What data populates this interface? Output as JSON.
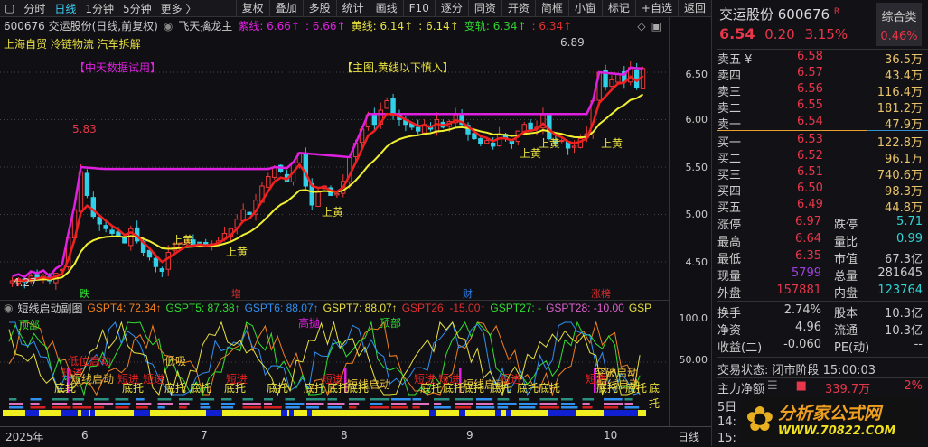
{
  "toolbar": {
    "items": [
      "分时",
      "日线",
      "1分钟",
      "5分钟",
      "更多 〉"
    ],
    "right": [
      "复权",
      "叠加",
      "多股",
      "统计",
      "画线",
      "F10",
      "逐分",
      "同资",
      "开资",
      "简框",
      "小窗",
      "标记",
      "+自选",
      "返回"
    ]
  },
  "info": {
    "title": "600676 交运股份(日线,前复权)",
    "indicator": "飞天擒龙主",
    "zx": "紫线: 6.66↑",
    "zx2": ": 6.66↑",
    "hx": "黄线: 6.14↑",
    "hx2": ": 6.14↑",
    "bg": "变轨: 6.34↑",
    "bg2": ": 6.34↑"
  },
  "main": {
    "concepts": "上海自贸 冷链物流 汽车拆解",
    "trial": "【中天数据试用】",
    "note": "【主图,黄线以下慎入】",
    "high_label": "5.83",
    "peak_label": "6.89",
    "low_label": "4.27",
    "shang_huang": "上黄",
    "events": [
      "跌",
      "增",
      "财",
      "涨榜"
    ],
    "yaxis": [
      "6.50",
      "6.00",
      "5.50",
      "5.00",
      "4.50"
    ]
  },
  "chart_data": {
    "type": "candlestick",
    "ylim": [
      4.2,
      6.95
    ],
    "closes": [
      4.3,
      4.32,
      4.29,
      4.35,
      4.33,
      4.36,
      4.3,
      4.38,
      4.42,
      4.75,
      5.05,
      5.45,
      5.2,
      4.98,
      4.9,
      4.85,
      4.8,
      4.78,
      4.7,
      4.85,
      4.72,
      4.6,
      4.55,
      4.45,
      4.4,
      4.6,
      4.65,
      4.7,
      4.72,
      4.68,
      4.7,
      4.66,
      4.69,
      4.72,
      4.8,
      4.85,
      4.95,
      5.05,
      5.0,
      5.15,
      5.3,
      5.4,
      5.5,
      5.45,
      5.35,
      5.55,
      5.65,
      5.3,
      5.1,
      5.25,
      5.3,
      5.2,
      5.22,
      5.35,
      5.6,
      5.75,
      5.9,
      6.05,
      5.95,
      6.1,
      6.2,
      6.05,
      6.0,
      5.95,
      5.92,
      5.88,
      5.95,
      5.9,
      6.0,
      5.92,
      5.98,
      6.05,
      5.95,
      5.85,
      5.8,
      5.75,
      5.78,
      5.72,
      5.85,
      5.8,
      5.75,
      5.88,
      5.95,
      5.9,
      5.92,
      6.05,
      5.8,
      5.75,
      5.78,
      5.7,
      5.72,
      5.8,
      5.85,
      6.2,
      6.5,
      6.35,
      6.42,
      6.48,
      6.4,
      6.55,
      6.34,
      6.54
    ]
  },
  "sub": {
    "title": "短线启动副图",
    "gspt4": "GSPT4: 72.34↑",
    "gspt5": "GSPT5: 87.38↑",
    "gspt6": "GSPT6: 88.07↑",
    "gspt7": "GSPT7: 88.07↑",
    "gspt26": "GSPT26: -15.00↑",
    "gspt27": "GSPT27: -",
    "gspt28": "GSPT28: -10.00",
    "gsp": "GSP",
    "yaxis": [
      "100.0",
      "50.00"
    ],
    "labels": [
      {
        "t": "顶部",
        "c": "#30e030",
        "x": 20,
        "y": 2
      },
      {
        "t": "高抛",
        "c": "#e020e0",
        "x": 330,
        "y": 0
      },
      {
        "t": "顶部",
        "c": "#30e030",
        "x": 420,
        "y": 0
      },
      {
        "t": "低位启动",
        "c": "#e82020",
        "x": 75,
        "y": 32
      },
      {
        "t": "短进",
        "c": "#e82020",
        "x": 68,
        "y": 45
      },
      {
        "t": "短线启动",
        "c": "#e8c040",
        "x": 78,
        "y": 52
      },
      {
        "t": "短进",
        "c": "#e82020",
        "x": 130,
        "y": 52
      },
      {
        "t": "短进",
        "c": "#e82020",
        "x": 158,
        "y": 52
      },
      {
        "t": "低吸",
        "c": "#e8c040",
        "x": 182,
        "y": 32
      },
      {
        "t": "短进",
        "c": "#e82020",
        "x": 250,
        "y": 52
      },
      {
        "t": "短进",
        "c": "#e82020",
        "x": 356,
        "y": 52
      },
      {
        "t": "短线启动",
        "c": "#e8c040",
        "x": 384,
        "y": 58
      },
      {
        "t": "短进",
        "c": "#e82020",
        "x": 458,
        "y": 52
      },
      {
        "t": "短进",
        "c": "#e82020",
        "x": 485,
        "y": 52
      },
      {
        "t": "短线启动",
        "c": "#e8c040",
        "x": 512,
        "y": 58
      },
      {
        "t": "短进",
        "c": "#e82020",
        "x": 553,
        "y": 52
      },
      {
        "t": "突破启动",
        "c": "#e8c040",
        "x": 658,
        "y": 45
      },
      {
        "t": "短进",
        "c": "#e82020",
        "x": 648,
        "y": 52
      },
      {
        "t": "短线启动",
        "c": "#e8c040",
        "x": 660,
        "y": 58
      }
    ],
    "bottom_label": "底托",
    "bottom_x": [
      60,
      135,
      182,
      210,
      248,
      295,
      336,
      362,
      384,
      465,
      490,
      512,
      542,
      572,
      596,
      660,
      692,
      718
    ]
  },
  "dates": {
    "year": "2025年",
    "months": [
      "6",
      "7",
      "8",
      "9",
      "10"
    ],
    "period": "日线"
  },
  "panel": {
    "name": "交运股份 600676",
    "r": "R",
    "price": "6.54",
    "chg": "0.20",
    "pct": "3.15%",
    "sector": "综合类",
    "sector_pct": "0.46%",
    "asks": [
      {
        "l": "卖五 ¥",
        "p": "6.58",
        "v": "36.5万"
      },
      {
        "l": "卖四",
        "p": "6.57",
        "v": "43.4万"
      },
      {
        "l": "卖三",
        "p": "6.56",
        "v": "116.4万"
      },
      {
        "l": "卖二",
        "p": "6.55",
        "v": "181.2万"
      },
      {
        "l": "卖一",
        "p": "6.54",
        "v": "47.9万"
      }
    ],
    "bids": [
      {
        "l": "买一",
        "p": "6.53",
        "v": "122.8万"
      },
      {
        "l": "买二",
        "p": "6.52",
        "v": "96.1万"
      },
      {
        "l": "买三",
        "p": "6.51",
        "v": "740.6万"
      },
      {
        "l": "买四",
        "p": "6.50",
        "v": "98.3万"
      },
      {
        "l": "买五",
        "p": "6.49",
        "v": "44.8万"
      }
    ],
    "stats": [
      [
        "涨停",
        "6.97",
        "red",
        "跌停",
        "5.71",
        "cyan"
      ],
      [
        "最高",
        "6.64",
        "red",
        "量比",
        "0.99",
        "cyan"
      ],
      [
        "最低",
        "6.35",
        "red",
        "市值",
        "67.3亿",
        ""
      ],
      [
        "现量",
        "5799",
        "pur",
        "总量",
        "281645",
        ""
      ],
      [
        "外盘",
        "157881",
        "red",
        "内盘",
        "123764",
        "cyan"
      ]
    ],
    "stats2": [
      [
        "换手",
        "2.74%",
        "股本",
        "10.3亿"
      ],
      [
        "净资",
        "4.96",
        "流通",
        "10.3亿"
      ],
      [
        "收益(二)",
        "-0.060",
        "PE(动)",
        "--"
      ]
    ],
    "status": "交易状态: 闭市阶段 15:00:03",
    "net_label": "主力净额",
    "net_val": "339.7万",
    "net_pct": "2%",
    "five_day": "5日",
    "t1": "14:",
    "t2": "15:",
    "watermark": {
      "name": "分析家公式网",
      "url": "WWW.70822.COM"
    }
  }
}
